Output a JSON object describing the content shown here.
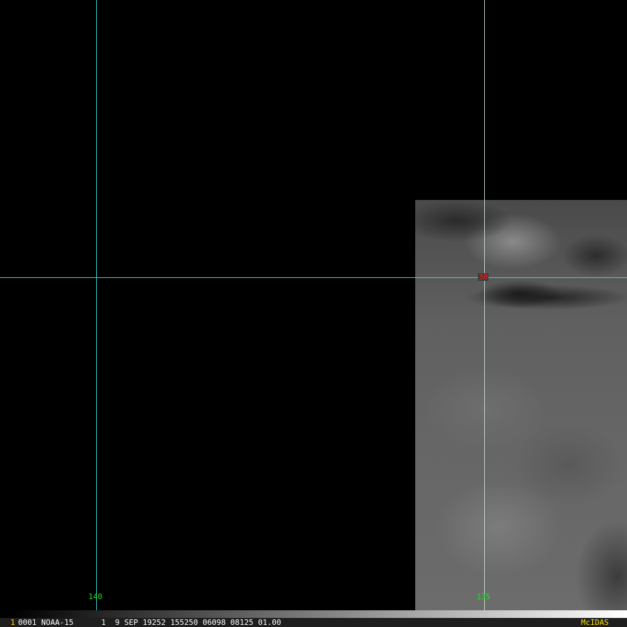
{
  "image": {
    "satellite_region": "visible imagery",
    "grid": {
      "longitude_labels": [
        "140",
        "135"
      ],
      "latitude_labels": [
        "30"
      ],
      "grid_color": "#2fd8dc",
      "lon_label_color": "#22e022",
      "lat_label_color": "#ff2020"
    }
  },
  "status_bar": {
    "frame_number": "1",
    "info": "0001 NOAA-15      1  9 SEP 19252 155250 06098 08125 01.00",
    "brand": "McIDAS"
  }
}
